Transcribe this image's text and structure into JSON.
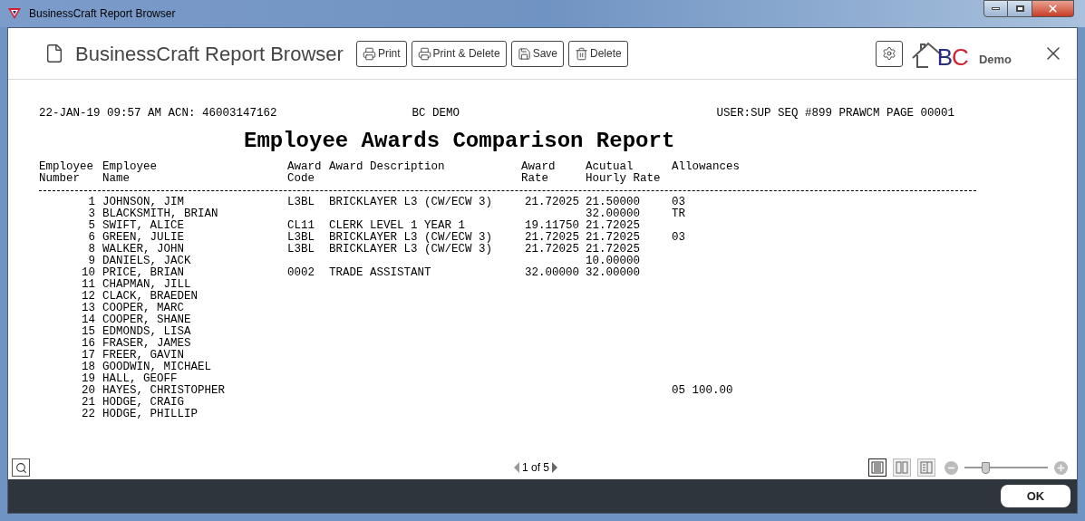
{
  "window": {
    "title": "BusinessCraft Report Browser"
  },
  "header": {
    "title": "BusinessCraft Report Browser",
    "buttons": [
      {
        "label": "Print",
        "kind": "print"
      },
      {
        "label": "Print & Delete",
        "kind": "print"
      },
      {
        "label": "Save",
        "kind": "save"
      },
      {
        "label": "Delete",
        "kind": "delete"
      }
    ],
    "logo": {
      "letters": [
        {
          "text": "B",
          "color": "#2b2d7e"
        },
        {
          "text": "C",
          "color": "#d3202f"
        }
      ],
      "caption": "Demo"
    }
  },
  "report": {
    "meta_left": "22-JAN-19 09:57 AM ACN: 46003147162",
    "meta_center": "BC DEMO",
    "meta_right": "USER:SUP SEQ #899 PRAWCM PAGE 00001",
    "title": "Employee Awards Comparison Report",
    "columns": [
      {
        "lines": [
          "Employee",
          "Number"
        ]
      },
      {
        "lines": [
          "Employee",
          "Name"
        ]
      },
      {
        "lines": [
          "Award",
          "Code"
        ]
      },
      {
        "lines": [
          "Award Description"
        ]
      },
      {
        "lines": [
          "Award",
          "Rate"
        ]
      },
      {
        "lines": [
          "Acutual",
          "Hourly Rate"
        ]
      },
      {
        "lines": [
          "Allowances"
        ]
      }
    ],
    "rows": [
      {
        "number": "1",
        "name": "JOHNSON, JIM",
        "award_code": "L3BL",
        "award_description": "BRICKLAYER L3 (CW/ECW 3)",
        "award_rate": "21.72025",
        "actual_hourly_rate": "21.50000",
        "allowances": "03"
      },
      {
        "number": "3",
        "name": "BLACKSMITH, BRIAN",
        "actual_hourly_rate": "32.00000",
        "allowances": "TR"
      },
      {
        "number": "5",
        "name": "SWIFT, ALICE",
        "award_code": "CL11",
        "award_description": "CLERK LEVEL 1 YEAR 1",
        "award_rate": "19.11750",
        "actual_hourly_rate": "21.72025"
      },
      {
        "number": "6",
        "name": "GREEN, JULIE",
        "award_code": "L3BL",
        "award_description": "BRICKLAYER L3 (CW/ECW 3)",
        "award_rate": "21.72025",
        "actual_hourly_rate": "21.72025",
        "allowances": "03"
      },
      {
        "number": "8",
        "name": "WALKER, JOHN",
        "award_code": "L3BL",
        "award_description": "BRICKLAYER L3 (CW/ECW 3)",
        "award_rate": "21.72025",
        "actual_hourly_rate": "21.72025"
      },
      {
        "number": "9",
        "name": "DANIELS, JACK",
        "actual_hourly_rate": "10.00000"
      },
      {
        "number": "10",
        "name": "PRICE, BRIAN",
        "award_code": "0002",
        "award_description": "TRADE ASSISTANT",
        "award_rate": "32.00000",
        "actual_hourly_rate": "32.00000"
      },
      {
        "number": "11",
        "name": "CHAPMAN, JILL"
      },
      {
        "number": "12",
        "name": "CLACK, BRAEDEN"
      },
      {
        "number": "13",
        "name": "COOPER, MARC"
      },
      {
        "number": "14",
        "name": "COOPER, SHANE"
      },
      {
        "number": "15",
        "name": "EDMONDS, LISA"
      },
      {
        "number": "16",
        "name": "FRASER, JAMES"
      },
      {
        "number": "17",
        "name": "FREER, GAVIN"
      },
      {
        "number": "18",
        "name": "GOODWIN, MICHAEL"
      },
      {
        "number": "19",
        "name": "HALL, GEOFF"
      },
      {
        "number": "20",
        "name": "HAYES, CHRISTOPHER",
        "allowances": "05 100.00"
      },
      {
        "number": "21",
        "name": "HODGE, CRAIG"
      },
      {
        "number": "22",
        "name": "HODGE, PHILLIP"
      }
    ]
  },
  "toolbar": {
    "pager": "1 of 5",
    "views": [
      {
        "kind": "single",
        "selected": true
      },
      {
        "kind": "double",
        "selected": false
      },
      {
        "kind": "side",
        "selected": false
      }
    ],
    "zoom": {
      "level": 0.25
    }
  },
  "footer": {
    "ok": "OK"
  }
}
